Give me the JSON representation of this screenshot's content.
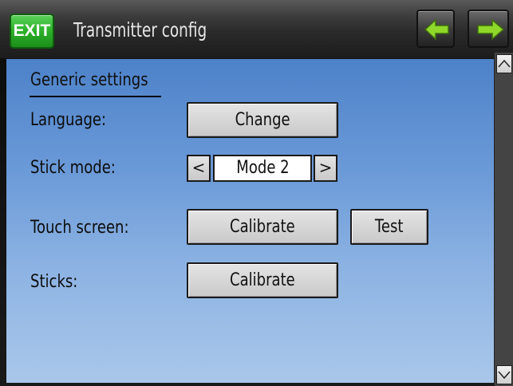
{
  "header": {
    "exit_label": "EXIT",
    "title": "Transmitter config",
    "prev_icon": "arrow-left-icon",
    "next_icon": "arrow-right-icon",
    "accent_color": "#2fb32c",
    "arrow_color": "#8fd82a"
  },
  "section": {
    "title": "Generic settings"
  },
  "rows": {
    "language": {
      "label": "Language:",
      "button": "Change"
    },
    "stick_mode": {
      "label": "Stick mode:",
      "value": "Mode 2",
      "prev": "<",
      "next": ">"
    },
    "touch_screen": {
      "label": "Touch screen:",
      "calibrate": "Calibrate",
      "test": "Test"
    },
    "sticks": {
      "label": "Sticks:",
      "calibrate": "Calibrate"
    }
  },
  "scrollbar": {
    "up_icon": "chevron-up-icon",
    "down_icon": "chevron-down-icon"
  }
}
